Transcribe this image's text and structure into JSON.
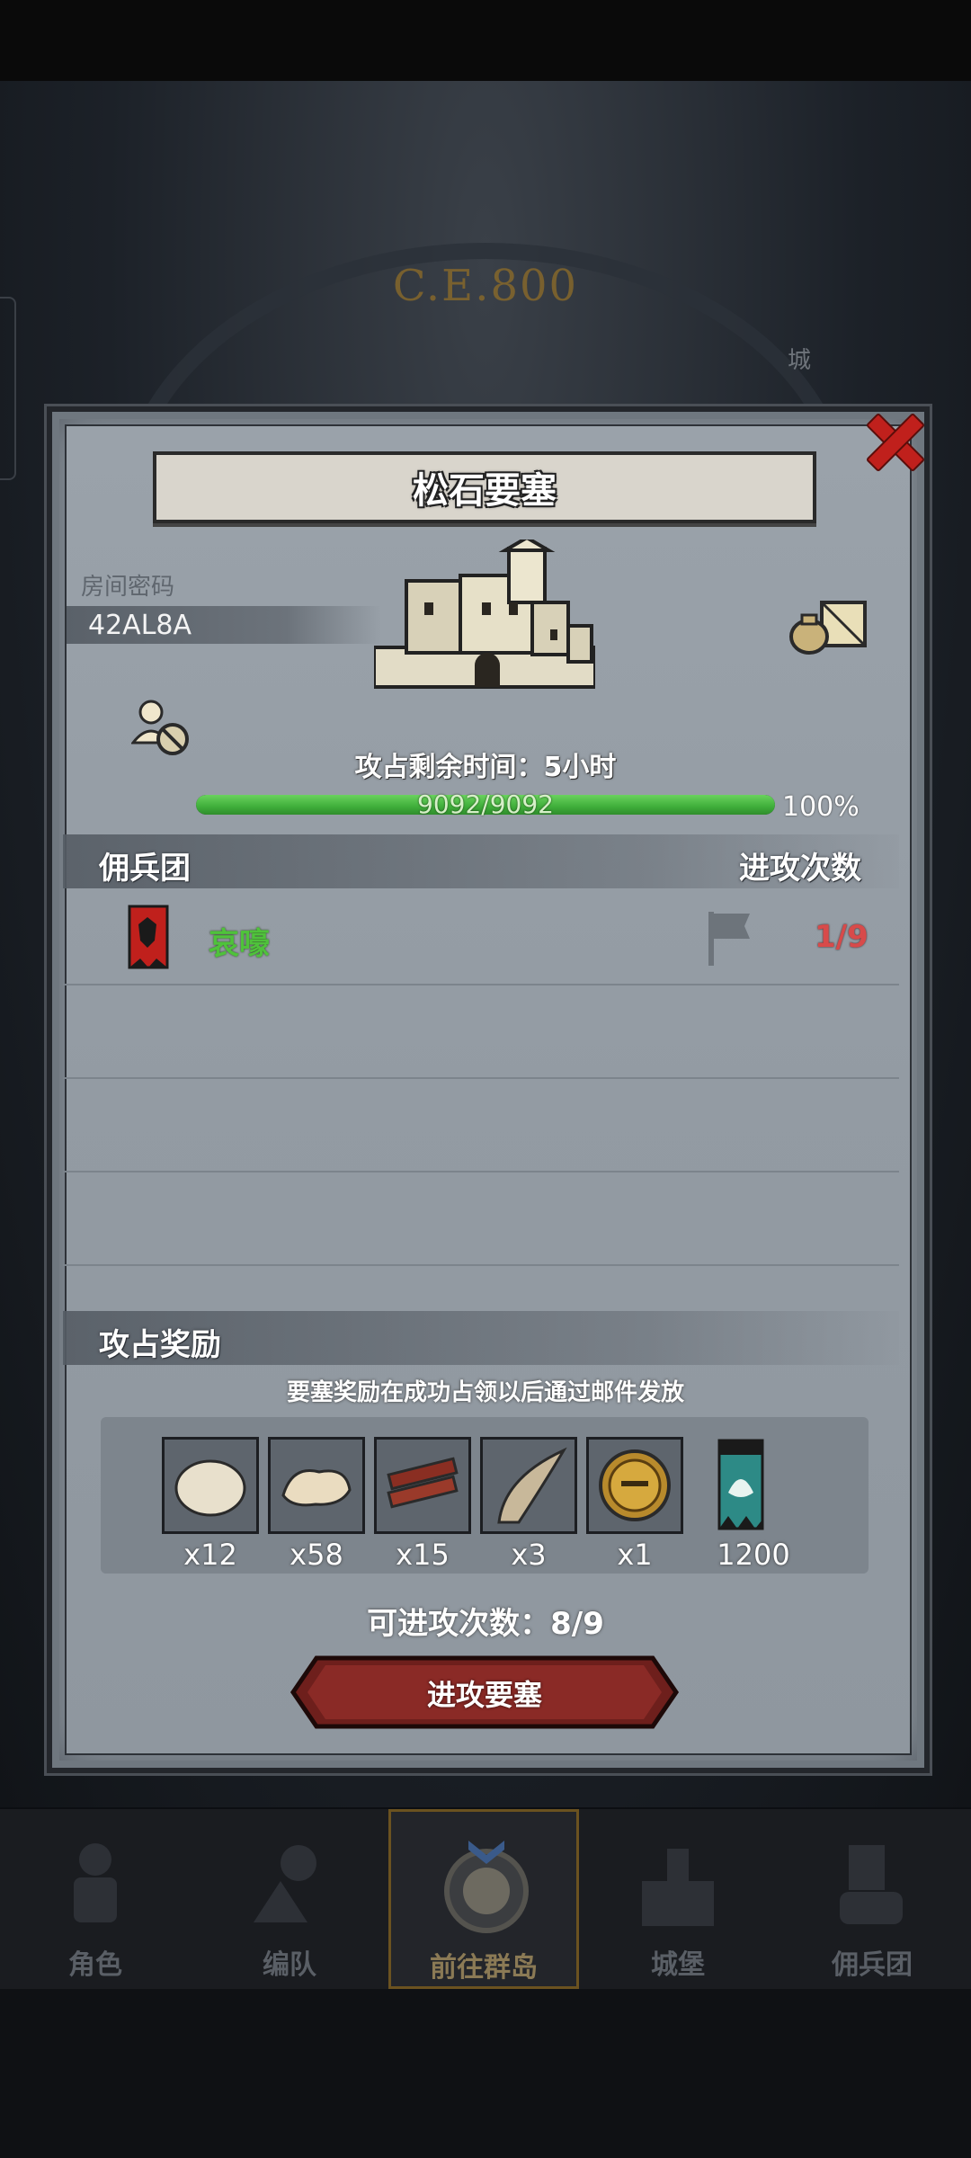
{
  "background": {
    "era_label": "C.E.800",
    "city_label": "城"
  },
  "dialog": {
    "title": "松石要塞",
    "room_password_label": "房间密码",
    "room_code": "42AL8A",
    "remaining_time_text": "攻占剩余时间：5小时",
    "hp": {
      "current": 9092,
      "max": 9092,
      "text": "9092/9092",
      "percent_text": "100%",
      "fraction": 1.0
    },
    "mercenary_header": "佣兵团",
    "attack_count_header": "进攻次数",
    "mercenaries": [
      {
        "name": "哀嚎",
        "attacks": "1/9"
      }
    ],
    "reward_header": "攻占奖励",
    "reward_note": "要塞奖励在成功占领以后通过邮件发放",
    "rewards": [
      {
        "icon": "fur-pelt-icon",
        "qty": "x12"
      },
      {
        "icon": "wool-hide-icon",
        "qty": "x58"
      },
      {
        "icon": "wood-planks-icon",
        "qty": "x15"
      },
      {
        "icon": "horn-icon",
        "qty": "x3"
      },
      {
        "icon": "knight-helmet-medal-icon",
        "qty": "x1"
      },
      {
        "icon": "guild-banner-icon",
        "qty": "1200"
      }
    ],
    "remaining_attacks_text": "可进攻次数：8/9",
    "attack_button_label": "进攻要塞"
  },
  "bottom_nav": {
    "tabs": [
      {
        "label": "角色",
        "icon": "character-icon"
      },
      {
        "label": "编队",
        "icon": "formation-icon"
      },
      {
        "label": "前往群岛",
        "icon": "islands-compass-icon",
        "active": true
      },
      {
        "label": "城堡",
        "icon": "castle-icon"
      },
      {
        "label": "佣兵团",
        "icon": "mercenary-icon"
      }
    ]
  },
  "colors": {
    "hp_green": "#3fae3a",
    "attack_red": "#d84a4a",
    "merc_green": "#4fc23b",
    "button_red": "#7a1e1c",
    "close_red": "#c0201c"
  }
}
